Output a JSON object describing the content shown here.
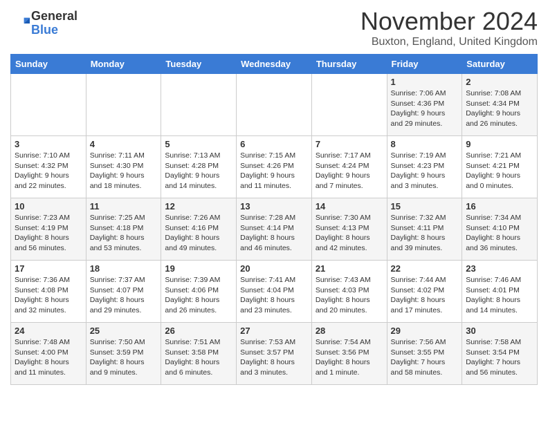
{
  "logo": {
    "general": "General",
    "blue": "Blue"
  },
  "title": "November 2024",
  "location": "Buxton, England, United Kingdom",
  "days_of_week": [
    "Sunday",
    "Monday",
    "Tuesday",
    "Wednesday",
    "Thursday",
    "Friday",
    "Saturday"
  ],
  "weeks": [
    [
      {
        "day": "",
        "info": ""
      },
      {
        "day": "",
        "info": ""
      },
      {
        "day": "",
        "info": ""
      },
      {
        "day": "",
        "info": ""
      },
      {
        "day": "",
        "info": ""
      },
      {
        "day": "1",
        "info": "Sunrise: 7:06 AM\nSunset: 4:36 PM\nDaylight: 9 hours and 29 minutes."
      },
      {
        "day": "2",
        "info": "Sunrise: 7:08 AM\nSunset: 4:34 PM\nDaylight: 9 hours and 26 minutes."
      }
    ],
    [
      {
        "day": "3",
        "info": "Sunrise: 7:10 AM\nSunset: 4:32 PM\nDaylight: 9 hours and 22 minutes."
      },
      {
        "day": "4",
        "info": "Sunrise: 7:11 AM\nSunset: 4:30 PM\nDaylight: 9 hours and 18 minutes."
      },
      {
        "day": "5",
        "info": "Sunrise: 7:13 AM\nSunset: 4:28 PM\nDaylight: 9 hours and 14 minutes."
      },
      {
        "day": "6",
        "info": "Sunrise: 7:15 AM\nSunset: 4:26 PM\nDaylight: 9 hours and 11 minutes."
      },
      {
        "day": "7",
        "info": "Sunrise: 7:17 AM\nSunset: 4:24 PM\nDaylight: 9 hours and 7 minutes."
      },
      {
        "day": "8",
        "info": "Sunrise: 7:19 AM\nSunset: 4:23 PM\nDaylight: 9 hours and 3 minutes."
      },
      {
        "day": "9",
        "info": "Sunrise: 7:21 AM\nSunset: 4:21 PM\nDaylight: 9 hours and 0 minutes."
      }
    ],
    [
      {
        "day": "10",
        "info": "Sunrise: 7:23 AM\nSunset: 4:19 PM\nDaylight: 8 hours and 56 minutes."
      },
      {
        "day": "11",
        "info": "Sunrise: 7:25 AM\nSunset: 4:18 PM\nDaylight: 8 hours and 53 minutes."
      },
      {
        "day": "12",
        "info": "Sunrise: 7:26 AM\nSunset: 4:16 PM\nDaylight: 8 hours and 49 minutes."
      },
      {
        "day": "13",
        "info": "Sunrise: 7:28 AM\nSunset: 4:14 PM\nDaylight: 8 hours and 46 minutes."
      },
      {
        "day": "14",
        "info": "Sunrise: 7:30 AM\nSunset: 4:13 PM\nDaylight: 8 hours and 42 minutes."
      },
      {
        "day": "15",
        "info": "Sunrise: 7:32 AM\nSunset: 4:11 PM\nDaylight: 8 hours and 39 minutes."
      },
      {
        "day": "16",
        "info": "Sunrise: 7:34 AM\nSunset: 4:10 PM\nDaylight: 8 hours and 36 minutes."
      }
    ],
    [
      {
        "day": "17",
        "info": "Sunrise: 7:36 AM\nSunset: 4:08 PM\nDaylight: 8 hours and 32 minutes."
      },
      {
        "day": "18",
        "info": "Sunrise: 7:37 AM\nSunset: 4:07 PM\nDaylight: 8 hours and 29 minutes."
      },
      {
        "day": "19",
        "info": "Sunrise: 7:39 AM\nSunset: 4:06 PM\nDaylight: 8 hours and 26 minutes."
      },
      {
        "day": "20",
        "info": "Sunrise: 7:41 AM\nSunset: 4:04 PM\nDaylight: 8 hours and 23 minutes."
      },
      {
        "day": "21",
        "info": "Sunrise: 7:43 AM\nSunset: 4:03 PM\nDaylight: 8 hours and 20 minutes."
      },
      {
        "day": "22",
        "info": "Sunrise: 7:44 AM\nSunset: 4:02 PM\nDaylight: 8 hours and 17 minutes."
      },
      {
        "day": "23",
        "info": "Sunrise: 7:46 AM\nSunset: 4:01 PM\nDaylight: 8 hours and 14 minutes."
      }
    ],
    [
      {
        "day": "24",
        "info": "Sunrise: 7:48 AM\nSunset: 4:00 PM\nDaylight: 8 hours and 11 minutes."
      },
      {
        "day": "25",
        "info": "Sunrise: 7:50 AM\nSunset: 3:59 PM\nDaylight: 8 hours and 9 minutes."
      },
      {
        "day": "26",
        "info": "Sunrise: 7:51 AM\nSunset: 3:58 PM\nDaylight: 8 hours and 6 minutes."
      },
      {
        "day": "27",
        "info": "Sunrise: 7:53 AM\nSunset: 3:57 PM\nDaylight: 8 hours and 3 minutes."
      },
      {
        "day": "28",
        "info": "Sunrise: 7:54 AM\nSunset: 3:56 PM\nDaylight: 8 hours and 1 minute."
      },
      {
        "day": "29",
        "info": "Sunrise: 7:56 AM\nSunset: 3:55 PM\nDaylight: 7 hours and 58 minutes."
      },
      {
        "day": "30",
        "info": "Sunrise: 7:58 AM\nSunset: 3:54 PM\nDaylight: 7 hours and 56 minutes."
      }
    ]
  ]
}
